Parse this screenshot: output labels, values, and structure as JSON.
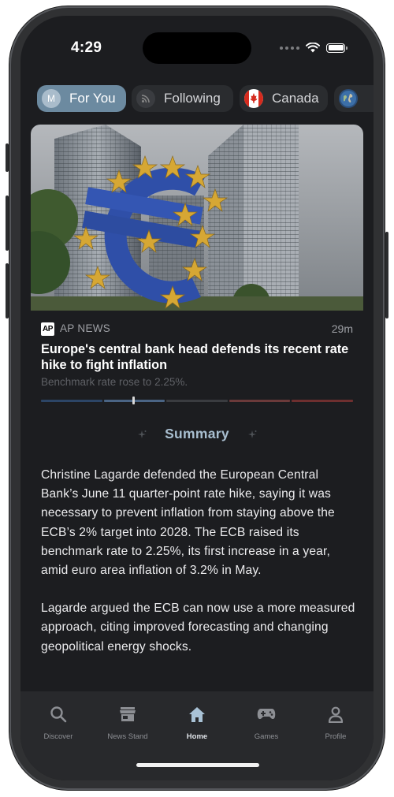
{
  "status_bar": {
    "time": "4:29"
  },
  "tabs": [
    {
      "label": "For You",
      "avatar_letter": "M",
      "active": true
    },
    {
      "label": "Following",
      "icon": "rss-icon"
    },
    {
      "label": "Canada",
      "icon": "canada-flag-icon"
    },
    {
      "label": "",
      "icon": "globe-icon"
    }
  ],
  "article": {
    "source": "AP NEWS",
    "source_logo": "AP",
    "age": "29m",
    "headline": "Europe's central bank head defends its recent rate hike to fight inflation",
    "subhead": "Benchmark rate rose to 2.25%.",
    "bias_colors": [
      "#2c4566",
      "#4a6484",
      "#3a3c40",
      "#6b3a3a",
      "#6e2f2f"
    ]
  },
  "summary": {
    "title": "Summary",
    "paragraphs": [
      "Christine Lagarde defended the European Central Bank’s June 11 quarter-point rate hike, saying it was necessary to prevent inflation from staying above the ECB’s 2% target into 2028. The ECB raised its benchmark rate to 2.25%, its first increase in a year, amid euro area inflation of 3.2% in May.",
      "Lagarde argued the ECB can now use a more measured approach, citing improved forecasting and changing geopolitical energy shocks."
    ]
  },
  "bottom_nav": [
    {
      "label": "Discover",
      "icon": "search-icon"
    },
    {
      "label": "News Stand",
      "icon": "store-icon"
    },
    {
      "label": "Home",
      "icon": "home-icon",
      "active": true
    },
    {
      "label": "Games",
      "icon": "gamepad-icon"
    },
    {
      "label": "Profile",
      "icon": "person-icon"
    }
  ],
  "colors": {
    "accent": "#6c8aa0",
    "background": "#1c1d20",
    "nav_background": "#28292c"
  }
}
